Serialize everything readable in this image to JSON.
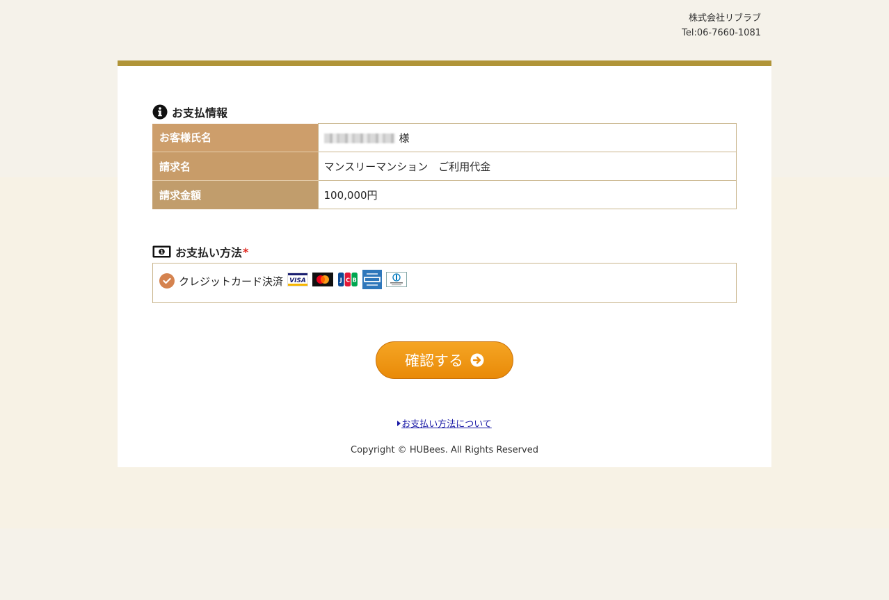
{
  "company": {
    "name": "株式会社リブラブ",
    "tel": "Tel:06-7660-1081"
  },
  "payment_info": {
    "title": "お支払情報",
    "rows": [
      {
        "label": "お客様氏名",
        "value": "様"
      },
      {
        "label": "請求名",
        "value": "マンスリーマンション　ご利用代金"
      },
      {
        "label": "請求金額",
        "value": "100,000円"
      }
    ]
  },
  "payment_method": {
    "title": "お支払い方法",
    "required_mark": "*",
    "option_label": "クレジットカード決済",
    "brands": [
      "VISA",
      "Mastercard",
      "JCB",
      "American Express",
      "Diners Club"
    ]
  },
  "confirm_label": "確認する",
  "help_link": "お支払い方法について",
  "copyright": "Copyright © HUBees. All Rights Reserved",
  "colors": {
    "gold": "#b09438",
    "orange": "#ef9412",
    "header_cell": "#cd9e6b"
  }
}
